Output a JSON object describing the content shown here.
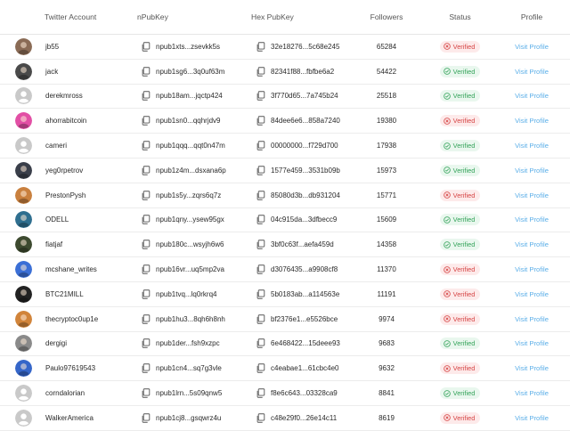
{
  "columns": {
    "account": "Twitter Account",
    "npub": "nPubKey",
    "hex": "Hex PubKey",
    "followers": "Followers",
    "status": "Status",
    "profile": "Profile"
  },
  "colors": {
    "verified": "#34a35a",
    "unverified": "#d64545",
    "link": "#5aaee8"
  },
  "rows": [
    {
      "name": "jb55",
      "npub": "npub1xts...zsevkk5s",
      "hex": "32e18276...5c68e245",
      "followers": "65284",
      "status": "Verified",
      "verified": false,
      "avatar": "photo",
      "color": "#8a6b55",
      "link": "Visit Profile"
    },
    {
      "name": "jack",
      "npub": "npub1sg6...3q0uf63m",
      "hex": "82341f88...fbfbe6a2",
      "followers": "54422",
      "status": "Verified",
      "verified": true,
      "avatar": "photo",
      "color": "#4a4a4a",
      "link": "Visit Profile"
    },
    {
      "name": "derekmross",
      "npub": "npub18am...jqctp424",
      "hex": "3f770d65...7a745b24",
      "followers": "25518",
      "status": "Verified",
      "verified": true,
      "avatar": "default",
      "color": "#bdbdbd",
      "link": "Visit Profile"
    },
    {
      "name": "ahorrabitcoin",
      "npub": "npub1sn0...qqhrjdv9",
      "hex": "84dee6e6...858a7240",
      "followers": "19380",
      "status": "Verified",
      "verified": false,
      "avatar": "photo",
      "color": "#e24fa5",
      "link": "Visit Profile"
    },
    {
      "name": "cameri",
      "npub": "npub1qqq...qqt0n47m",
      "hex": "00000000...f729d700",
      "followers": "17938",
      "status": "Verified",
      "verified": true,
      "avatar": "default",
      "color": "#bdbdbd",
      "link": "Visit Profile"
    },
    {
      "name": "yeg0rpetrov",
      "npub": "npub1z4m...dsxana6p",
      "hex": "1577e459...3531b09b",
      "followers": "15973",
      "status": "Verified",
      "verified": true,
      "avatar": "photo",
      "color": "#3a3f4a",
      "link": "Visit Profile"
    },
    {
      "name": "PrestonPysh",
      "npub": "npub1s5y...zqrs6q7z",
      "hex": "85080d3b...db931204",
      "followers": "15771",
      "status": "Verified",
      "verified": false,
      "avatar": "photo",
      "color": "#c9803e",
      "link": "Visit Profile"
    },
    {
      "name": "ODELL",
      "npub": "npub1qny...ysew95gx",
      "hex": "04c915da...3dfbecc9",
      "followers": "15609",
      "status": "Verified",
      "verified": true,
      "avatar": "photo",
      "color": "#2f6f8f",
      "link": "Visit Profile"
    },
    {
      "name": "fiatjaf",
      "npub": "npub180c...wsyjh6w6",
      "hex": "3bf0c63f...aefa459d",
      "followers": "14358",
      "status": "Verified",
      "verified": true,
      "avatar": "photo",
      "color": "#3d4a2f",
      "link": "Visit Profile"
    },
    {
      "name": "mcshane_writes",
      "npub": "npub16vr...uq5mp2va",
      "hex": "d3076435...a9908cf8",
      "followers": "11370",
      "status": "Verified",
      "verified": false,
      "avatar": "photo",
      "color": "#3b6fd6",
      "link": "Visit Profile"
    },
    {
      "name": "BTC21MILL",
      "npub": "npub1tvq...lq0rkrq4",
      "hex": "5b0183ab...a114563e",
      "followers": "11191",
      "status": "Verified",
      "verified": false,
      "avatar": "photo",
      "color": "#222222",
      "link": "Visit Profile"
    },
    {
      "name": "thecryptoc0up1e",
      "npub": "npub1hu3...8qh6h8nh",
      "hex": "bf2376e1...e5526bce",
      "followers": "9974",
      "status": "Verified",
      "verified": false,
      "avatar": "photo",
      "color": "#d1843a",
      "link": "Visit Profile"
    },
    {
      "name": "dergigi",
      "npub": "npub1der...fsh9xzpc",
      "hex": "6e468422...15deee93",
      "followers": "9683",
      "status": "Verified",
      "verified": true,
      "avatar": "photo",
      "color": "#8a8a8a",
      "link": "Visit Profile"
    },
    {
      "name": "Paulo97619543",
      "npub": "npub1cn4...sq7g3vle",
      "hex": "c4eabae1...61cbc4e0",
      "followers": "9632",
      "status": "Verified",
      "verified": false,
      "avatar": "photo",
      "color": "#3566c9",
      "link": "Visit Profile"
    },
    {
      "name": "corndalorian",
      "npub": "npub1lrn...5s09qnw5",
      "hex": "f8e6c643...03328ca9",
      "followers": "8841",
      "status": "Verified",
      "verified": true,
      "avatar": "default",
      "color": "#bdbdbd",
      "link": "Visit Profile"
    },
    {
      "name": "WalkerAmerica",
      "npub": "npub1cj8...gsqwrz4u",
      "hex": "c48e29f0...26e14c11",
      "followers": "8619",
      "status": "Verified",
      "verified": false,
      "avatar": "default",
      "color": "#bdbdbd",
      "link": "Visit Profile"
    }
  ]
}
